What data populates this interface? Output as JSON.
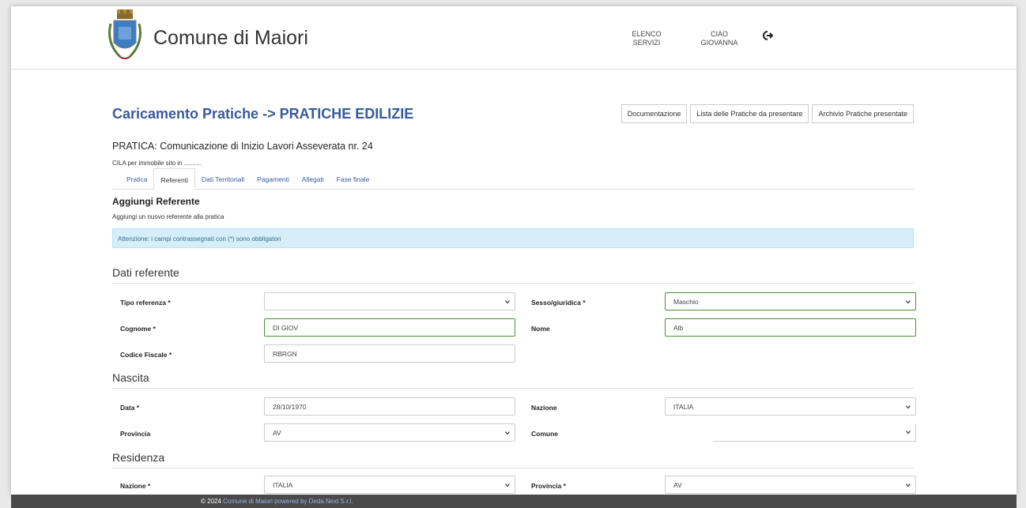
{
  "header": {
    "site_title": "Comune di Maiori",
    "nav_services": "ELENCO SERVIZI",
    "nav_user": "CIAO GIOVANNA"
  },
  "page": {
    "heading": "Caricamento Pratiche -> PRATICHE EDILIZIE",
    "buttons": [
      "Documentazione",
      "Lista delle Pratiche da presentare",
      "Archivio Pratiche presentate"
    ],
    "pratica_title": "PRATICA: Comunicazione di Inizio Lavori Asseverata nr. 24",
    "pratica_sub": "CILA per immobile sito in .........."
  },
  "tabs": [
    "Pratica",
    "Referenti",
    "Dati Territoriali",
    "Pagamenti",
    "Allegati",
    "Fase finale"
  ],
  "active_tab": "Referenti",
  "section": {
    "heading": "Aggiungi Referente",
    "sub": "Aggiungi un nuovo referente alla pratica",
    "alert": "Attenzione: i campi contrassegnati con (*) sono obbligatori"
  },
  "groups": {
    "dati_referente": "Dati referente",
    "nascita": "Nascita",
    "residenza": "Residenza"
  },
  "form": {
    "tipo_referenza": {
      "label": "Tipo referenza *",
      "value": ""
    },
    "sesso": {
      "label": "Sesso/giuridica *",
      "value": "Maschio"
    },
    "cognome": {
      "label": "Cognome *",
      "value": "DI GIOV"
    },
    "nome": {
      "label": "Nome",
      "value": "Alb"
    },
    "codice_fiscale": {
      "label": "Codice Fiscale *",
      "value": "RBRGN"
    },
    "data": {
      "label": "Data *",
      "value": "28/10/1970"
    },
    "nazione_nascita": {
      "label": "Nazione",
      "value": "ITALIA"
    },
    "provincia_nascita": {
      "label": "Provincia",
      "value": "AV"
    },
    "comune_nascita": {
      "label": "Comune",
      "value": ""
    },
    "nazione_residenza": {
      "label": "Nazione *",
      "value": "ITALIA"
    },
    "provincia_residenza": {
      "label": "Provincia *",
      "value": "AV"
    }
  },
  "footer": {
    "copyright": "© 2024",
    "link": "Comune di Maiori powered by Deda Next S.r.l."
  },
  "colors": {
    "accent": "#3a5a9a",
    "valid_border": "#4a8f3a",
    "alert_bg": "#d6eef8"
  }
}
